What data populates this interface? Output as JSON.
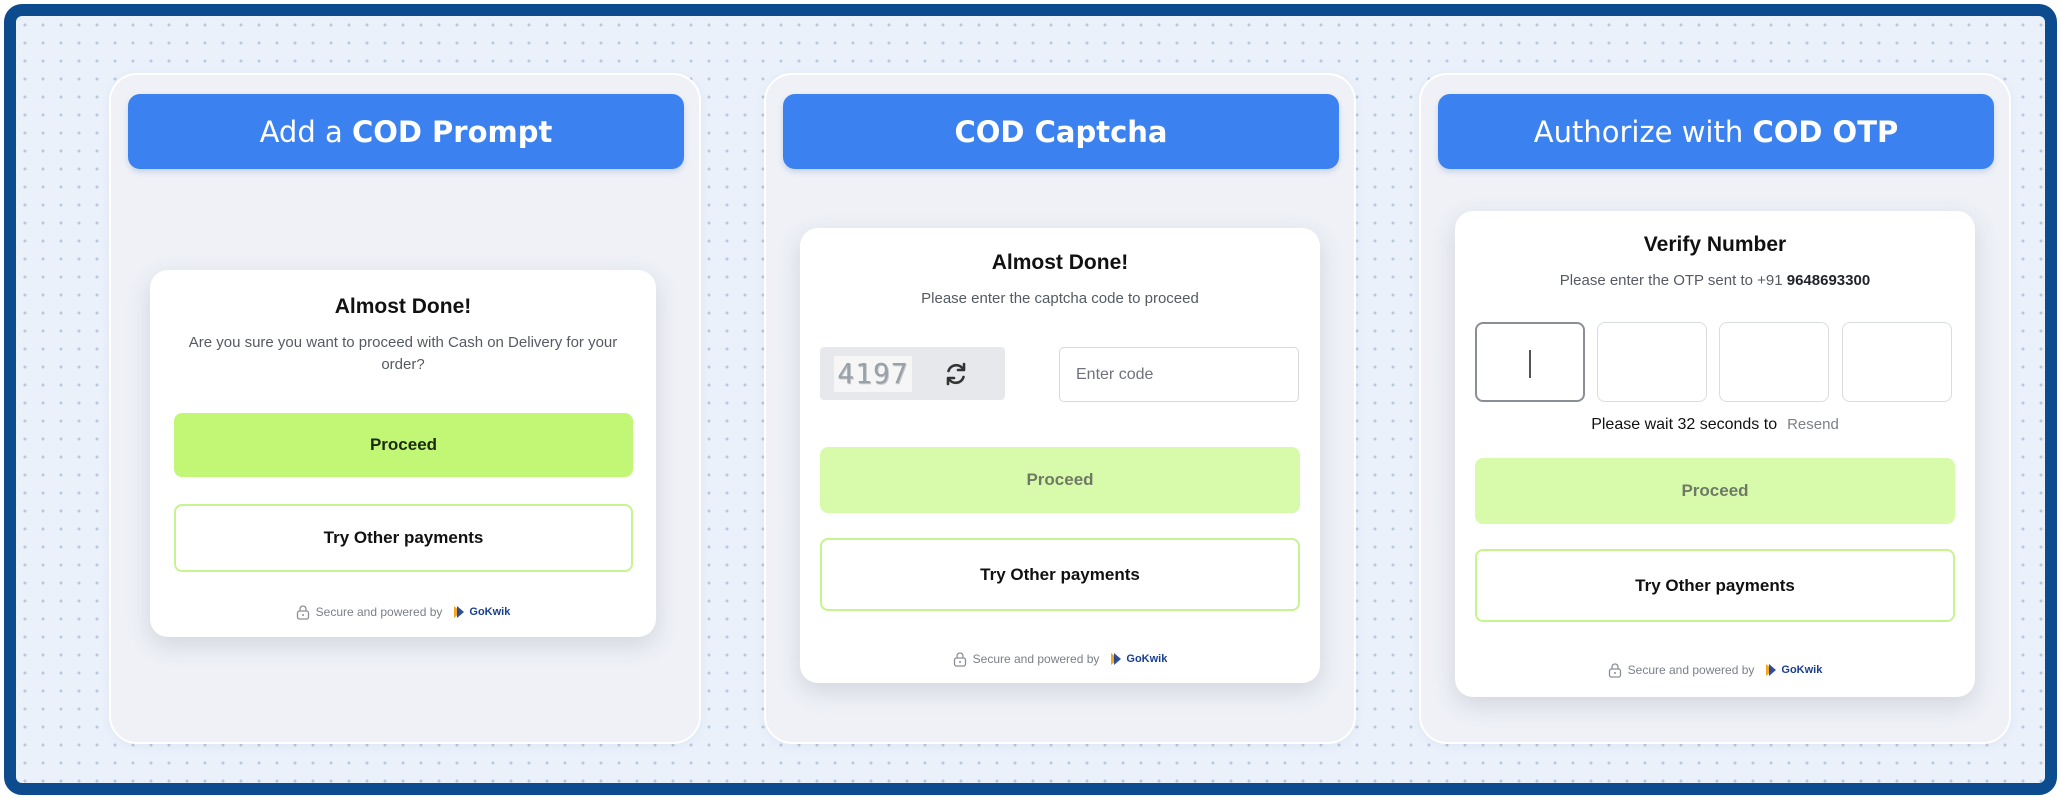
{
  "panels": [
    {
      "title_light": "Add a ",
      "title_bold": "COD Prompt",
      "card": {
        "title": "Almost Done!",
        "subtitle": "Are you sure you want to proceed with Cash on Delivery for your order?",
        "proceed_label": "Proceed",
        "other_label": "Try Other payments",
        "footer_text": "Secure and powered by",
        "brand": "GoKwik"
      }
    },
    {
      "title_light": "",
      "title_bold": "COD Captcha",
      "card": {
        "title": "Almost Done!",
        "subtitle": "Please enter the captcha code to proceed",
        "captcha_code": "4197",
        "input_placeholder": "Enter code",
        "input_value": "",
        "proceed_label": "Proceed",
        "other_label": "Try Other payments",
        "footer_text": "Secure and powered by",
        "brand": "GoKwik"
      }
    },
    {
      "title_light": "Authorize with ",
      "title_bold": "COD OTP",
      "card": {
        "title": "Verify Number",
        "subtitle_prefix": "Please enter the OTP sent to +91 ",
        "phone": "9648693300",
        "otp_digits": [
          "",
          "",
          "",
          ""
        ],
        "wait_text": "Please wait 32 seconds to",
        "resend_label": "Resend",
        "proceed_label": "Proceed",
        "other_label": "Try Other payments",
        "footer_text": "Secure and powered by",
        "brand": "GoKwik"
      }
    }
  ],
  "colors": {
    "frame_border": "#0d4b8f",
    "title_bar": "#3b82f0",
    "proceed": "#c1f775",
    "proceed_disabled": "#d8fbab",
    "outline_green": "#c6f48e"
  }
}
